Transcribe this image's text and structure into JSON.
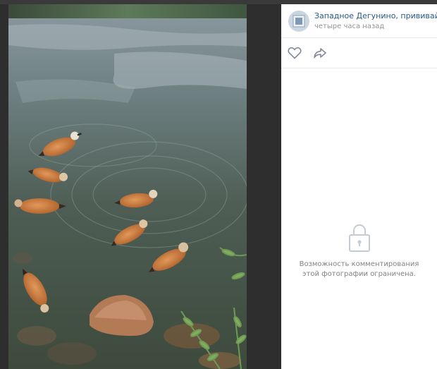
{
  "post": {
    "author": "Западное Дегунино, прививайся!",
    "time": "четыре часа назад"
  },
  "actions": {
    "like_icon": "heart-icon",
    "share_icon": "share-arrow-icon"
  },
  "comments": {
    "lock_icon": "lock-icon",
    "restricted_text": "Возможность комментирования этой фотографии ограничена."
  },
  "colors": {
    "link": "#2a5885",
    "muted": "#939393",
    "icon": "#828a99",
    "backdrop": "#2e2e2e"
  }
}
